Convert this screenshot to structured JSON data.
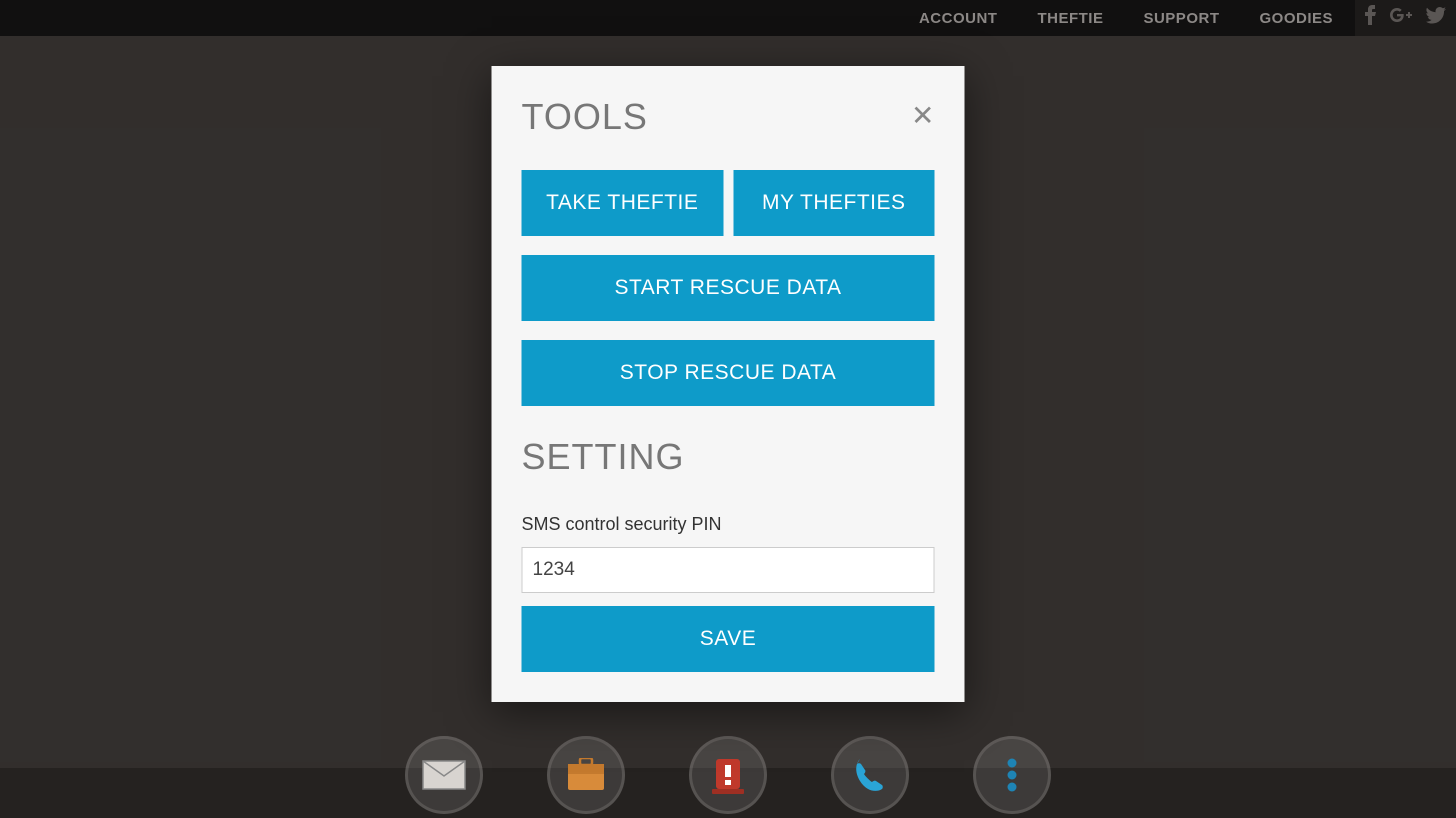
{
  "nav": {
    "items": [
      "ACCOUNT",
      "THEFTIE",
      "SUPPORT",
      "GOODIES"
    ]
  },
  "modal": {
    "title_tools": "TOOLS",
    "take_theftie": "TAKE THEFTIE",
    "my_thefties": "MY THEFTIES",
    "start_rescue": "START RESCUE DATA",
    "stop_rescue": "STOP RESCUE DATA",
    "title_setting": "SETTING",
    "pin_label": "SMS control security PIN",
    "pin_value": "1234",
    "save": "SAVE"
  }
}
